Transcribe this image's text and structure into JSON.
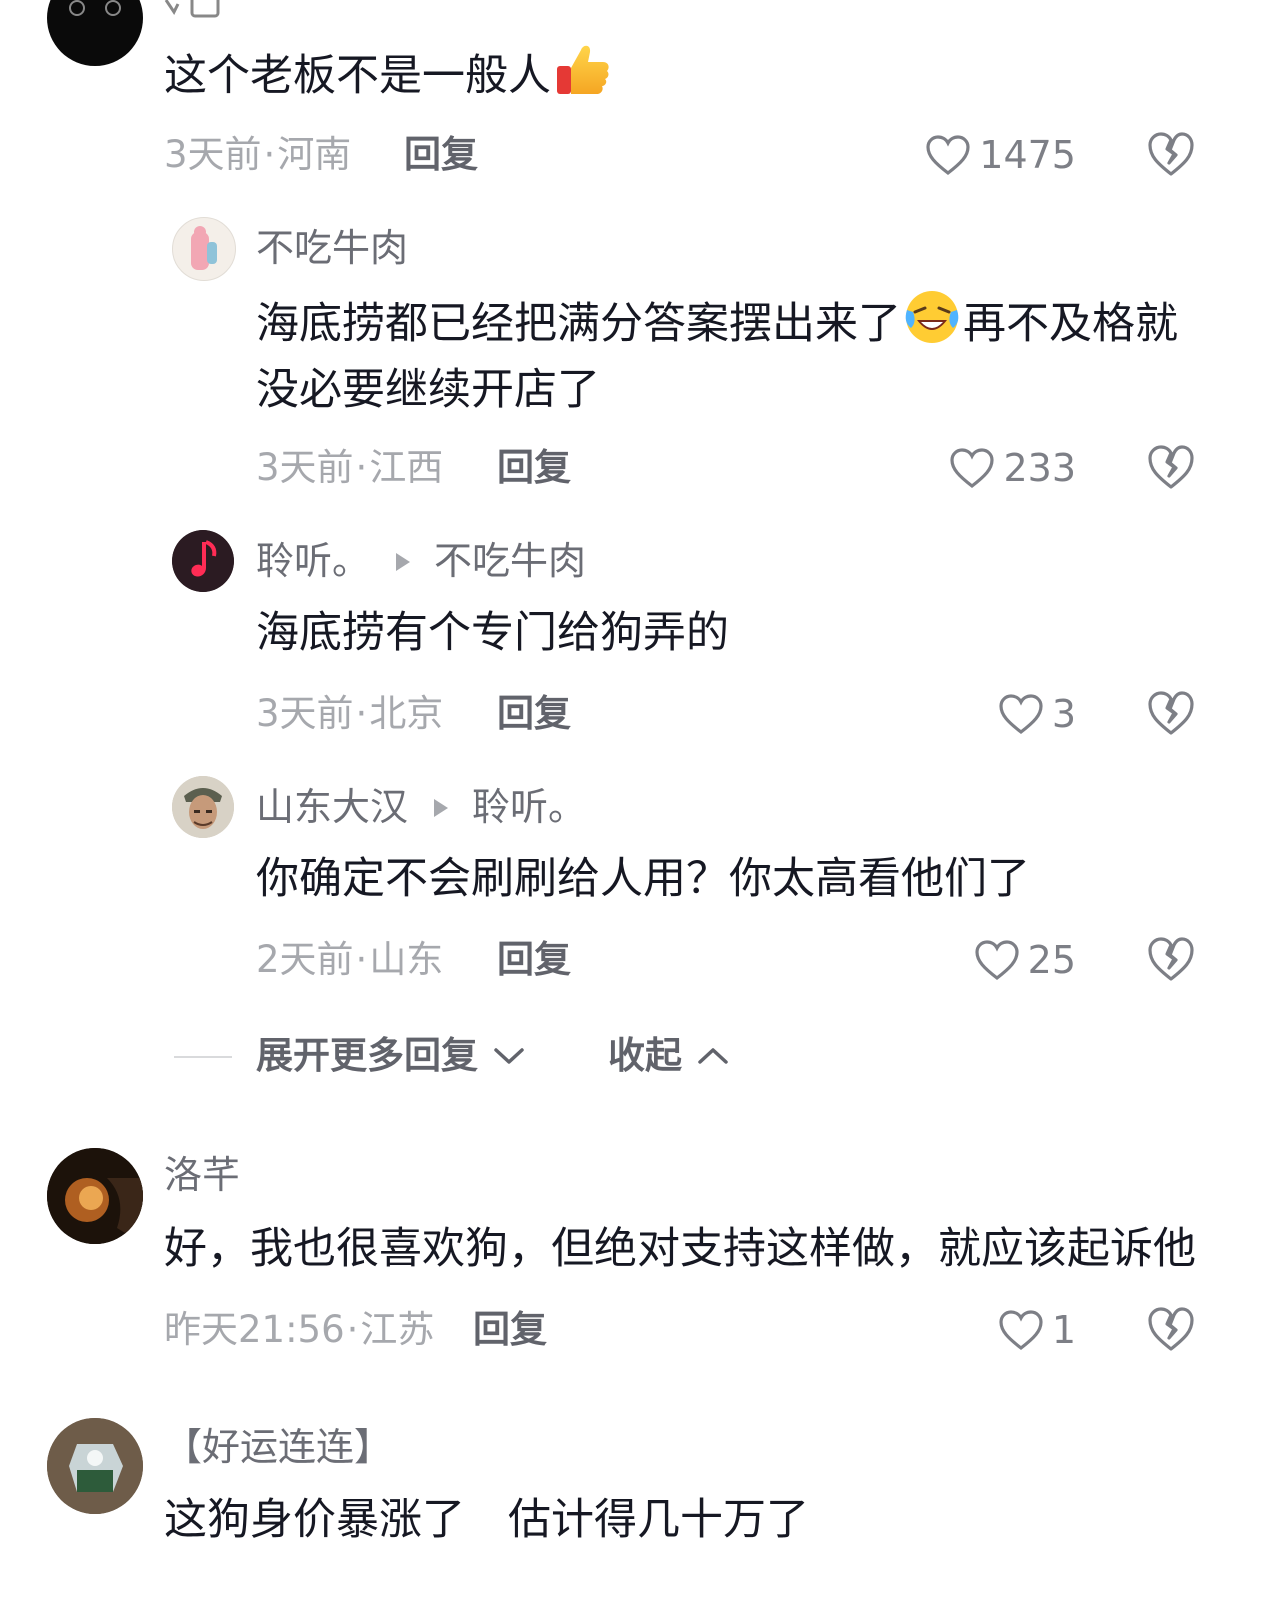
{
  "comments": [
    {
      "content_prefix": "这个老板不是一般人",
      "emoji": "thumbs-up",
      "time": "3天前",
      "location": "河南",
      "reply_label": "回复",
      "likes": "1475"
    },
    {
      "name": "不吃牛肉",
      "content_line1_prefix": "海底捞都已经把满分答案摆出来了",
      "emoji": "laughing-crying",
      "content_line1_suffix": "再不及格就",
      "content_line2": "没必要继续开店了",
      "time": "3天前",
      "location": "江西",
      "reply_label": "回复",
      "likes": "233"
    },
    {
      "name": "聆听。",
      "reply_to": "不吃牛肉",
      "content": "海底捞有个专门给狗弄的",
      "time": "3天前",
      "location": "北京",
      "reply_label": "回复",
      "likes": "3"
    },
    {
      "name": "山东大汉",
      "reply_to": "聆听。",
      "content": "你确定不会刷刷给人用？你太高看他们了",
      "time": "2天前",
      "location": "山东",
      "reply_label": "回复",
      "likes": "25"
    },
    {
      "name": "洛芊",
      "content": "好，我也很喜欢狗，但绝对支持这样做，就应该起诉他",
      "time": "昨天21:56",
      "location": "江苏",
      "reply_label": "回复",
      "likes": "1"
    },
    {
      "name": "【好运连连】",
      "content": "这狗身价暴涨了　估计得几十万了"
    }
  ],
  "thread": {
    "expand_label": "展开更多回复",
    "collapse_label": "收起"
  },
  "meta_separator": "·",
  "colors": {
    "text": "#161823",
    "muted": "#a6a8ad",
    "name": "#6b6d75",
    "action": "#61636b"
  }
}
